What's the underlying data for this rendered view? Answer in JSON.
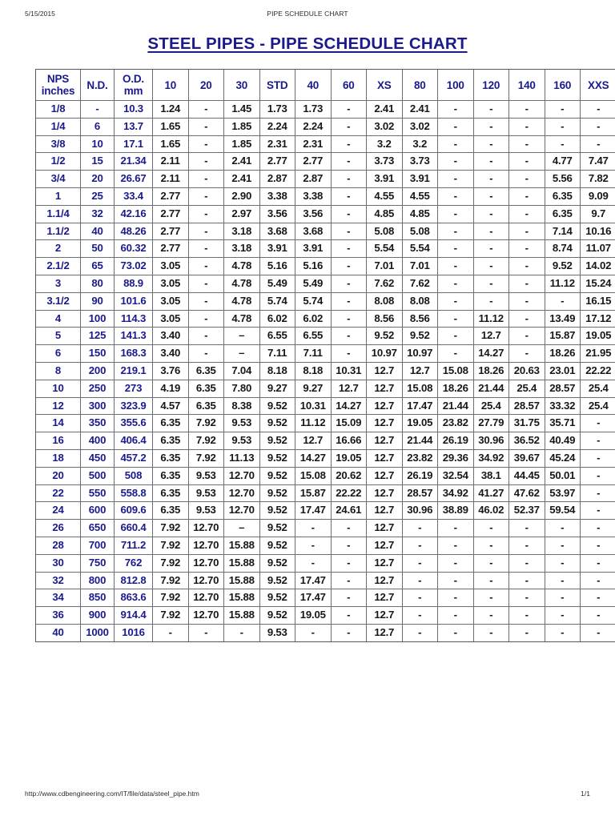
{
  "print_header": {
    "date": "5/15/2015",
    "title": "PIPE SCHEDULE CHART"
  },
  "print_footer": {
    "url": "http://www.cdbengineering.com/IT/file/data/steel_pipe.htm",
    "page": "1/1"
  },
  "document": {
    "title": "STEEL PIPES - PIPE SCHEDULE CHART",
    "title_color": "#1a1a8c"
  },
  "table": {
    "headers": [
      {
        "line1": "NPS",
        "line2": "inches"
      },
      {
        "line1": "N.D.",
        "line2": ""
      },
      {
        "line1": "O.D.",
        "line2": "mm"
      },
      {
        "line1": "10",
        "line2": ""
      },
      {
        "line1": "20",
        "line2": ""
      },
      {
        "line1": "30",
        "line2": ""
      },
      {
        "line1": "STD",
        "line2": ""
      },
      {
        "line1": "40",
        "line2": ""
      },
      {
        "line1": "60",
        "line2": ""
      },
      {
        "line1": "XS",
        "line2": ""
      },
      {
        "line1": "80",
        "line2": ""
      },
      {
        "line1": "100",
        "line2": ""
      },
      {
        "line1": "120",
        "line2": ""
      },
      {
        "line1": "140",
        "line2": ""
      },
      {
        "line1": "160",
        "line2": ""
      },
      {
        "line1": "XXS",
        "line2": ""
      }
    ],
    "rows": [
      [
        "1/8",
        "-",
        "10.3",
        "1.24",
        "-",
        "1.45",
        "1.73",
        "1.73",
        "-",
        "2.41",
        "2.41",
        "-",
        "-",
        "-",
        "-",
        "-"
      ],
      [
        "1/4",
        "6",
        "13.7",
        "1.65",
        "-",
        "1.85",
        "2.24",
        "2.24",
        "-",
        "3.02",
        "3.02",
        "-",
        "-",
        "-",
        "-",
        "-"
      ],
      [
        "3/8",
        "10",
        "17.1",
        "1.65",
        "-",
        "1.85",
        "2.31",
        "2.31",
        "-",
        "3.2",
        "3.2",
        "-",
        "-",
        "-",
        "-",
        "-"
      ],
      [
        "1/2",
        "15",
        "21.34",
        "2.11",
        "-",
        "2.41",
        "2.77",
        "2.77",
        "-",
        "3.73",
        "3.73",
        "-",
        "-",
        "-",
        "4.77",
        "7.47"
      ],
      [
        "3/4",
        "20",
        "26.67",
        "2.11",
        "-",
        "2.41",
        "2.87",
        "2.87",
        "-",
        "3.91",
        "3.91",
        "-",
        "-",
        "-",
        "5.56",
        "7.82"
      ],
      [
        "1",
        "25",
        "33.4",
        "2.77",
        "-",
        "2.90",
        "3.38",
        "3.38",
        "-",
        "4.55",
        "4.55",
        "-",
        "-",
        "-",
        "6.35",
        "9.09"
      ],
      [
        "1.1/4",
        "32",
        "42.16",
        "2.77",
        "-",
        "2.97",
        "3.56",
        "3.56",
        "-",
        "4.85",
        "4.85",
        "-",
        "-",
        "-",
        "6.35",
        "9.7"
      ],
      [
        "1.1/2",
        "40",
        "48.26",
        "2.77",
        "-",
        "3.18",
        "3.68",
        "3.68",
        "-",
        "5.08",
        "5.08",
        "-",
        "-",
        "-",
        "7.14",
        "10.16"
      ],
      [
        "2",
        "50",
        "60.32",
        "2.77",
        "-",
        "3.18",
        "3.91",
        "3.91",
        "-",
        "5.54",
        "5.54",
        "-",
        "-",
        "-",
        "8.74",
        "11.07"
      ],
      [
        "2.1/2",
        "65",
        "73.02",
        "3.05",
        "-",
        "4.78",
        "5.16",
        "5.16",
        "-",
        "7.01",
        "7.01",
        "-",
        "-",
        "-",
        "9.52",
        "14.02"
      ],
      [
        "3",
        "80",
        "88.9",
        "3.05",
        "-",
        "4.78",
        "5.49",
        "5.49",
        "-",
        "7.62",
        "7.62",
        "-",
        "-",
        "-",
        "11.12",
        "15.24"
      ],
      [
        "3.1/2",
        "90",
        "101.6",
        "3.05",
        "-",
        "4.78",
        "5.74",
        "5.74",
        "-",
        "8.08",
        "8.08",
        "-",
        "-",
        "-",
        "-",
        "16.15"
      ],
      [
        "4",
        "100",
        "114.3",
        "3.05",
        "-",
        "4.78",
        "6.02",
        "6.02",
        "-",
        "8.56",
        "8.56",
        "-",
        "11.12",
        "-",
        "13.49",
        "17.12"
      ],
      [
        "5",
        "125",
        "141.3",
        "3.40",
        "-",
        "–",
        "6.55",
        "6.55",
        "-",
        "9.52",
        "9.52",
        "-",
        "12.7",
        "-",
        "15.87",
        "19.05"
      ],
      [
        "6",
        "150",
        "168.3",
        "3.40",
        "-",
        "–",
        "7.11",
        "7.11",
        "-",
        "10.97",
        "10.97",
        "-",
        "14.27",
        "-",
        "18.26",
        "21.95"
      ],
      [
        "8",
        "200",
        "219.1",
        "3.76",
        "6.35",
        "7.04",
        "8.18",
        "8.18",
        "10.31",
        "12.7",
        "12.7",
        "15.08",
        "18.26",
        "20.63",
        "23.01",
        "22.22"
      ],
      [
        "10",
        "250",
        "273",
        "4.19",
        "6.35",
        "7.80",
        "9.27",
        "9.27",
        "12.7",
        "12.7",
        "15.08",
        "18.26",
        "21.44",
        "25.4",
        "28.57",
        "25.4"
      ],
      [
        "12",
        "300",
        "323.9",
        "4.57",
        "6.35",
        "8.38",
        "9.52",
        "10.31",
        "14.27",
        "12.7",
        "17.47",
        "21.44",
        "25.4",
        "28.57",
        "33.32",
        "25.4"
      ],
      [
        "14",
        "350",
        "355.6",
        "6.35",
        "7.92",
        "9.53",
        "9.52",
        "11.12",
        "15.09",
        "12.7",
        "19.05",
        "23.82",
        "27.79",
        "31.75",
        "35.71",
        "-"
      ],
      [
        "16",
        "400",
        "406.4",
        "6.35",
        "7.92",
        "9.53",
        "9.52",
        "12.7",
        "16.66",
        "12.7",
        "21.44",
        "26.19",
        "30.96",
        "36.52",
        "40.49",
        "-"
      ],
      [
        "18",
        "450",
        "457.2",
        "6.35",
        "7.92",
        "11.13",
        "9.52",
        "14.27",
        "19.05",
        "12.7",
        "23.82",
        "29.36",
        "34.92",
        "39.67",
        "45.24",
        "-"
      ],
      [
        "20",
        "500",
        "508",
        "6.35",
        "9.53",
        "12.70",
        "9.52",
        "15.08",
        "20.62",
        "12.7",
        "26.19",
        "32.54",
        "38.1",
        "44.45",
        "50.01",
        "-"
      ],
      [
        "22",
        "550",
        "558.8",
        "6.35",
        "9.53",
        "12.70",
        "9.52",
        "15.87",
        "22.22",
        "12.7",
        "28.57",
        "34.92",
        "41.27",
        "47.62",
        "53.97",
        "-"
      ],
      [
        "24",
        "600",
        "609.6",
        "6.35",
        "9.53",
        "12.70",
        "9.52",
        "17.47",
        "24.61",
        "12.7",
        "30.96",
        "38.89",
        "46.02",
        "52.37",
        "59.54",
        "-"
      ],
      [
        "26",
        "650",
        "660.4",
        "7.92",
        "12.70",
        "–",
        "9.52",
        "-",
        "-",
        "12.7",
        "-",
        "-",
        "-",
        "-",
        "-",
        "-"
      ],
      [
        "28",
        "700",
        "711.2",
        "7.92",
        "12.70",
        "15.88",
        "9.52",
        "-",
        "-",
        "12.7",
        "-",
        "-",
        "-",
        "-",
        "-",
        "-"
      ],
      [
        "30",
        "750",
        "762",
        "7.92",
        "12.70",
        "15.88",
        "9.52",
        "-",
        "-",
        "12.7",
        "-",
        "-",
        "-",
        "-",
        "-",
        "-"
      ],
      [
        "32",
        "800",
        "812.8",
        "7.92",
        "12.70",
        "15.88",
        "9.52",
        "17.47",
        "-",
        "12.7",
        "-",
        "-",
        "-",
        "-",
        "-",
        "-"
      ],
      [
        "34",
        "850",
        "863.6",
        "7.92",
        "12.70",
        "15.88",
        "9.52",
        "17.47",
        "-",
        "12.7",
        "-",
        "-",
        "-",
        "-",
        "-",
        "-"
      ],
      [
        "36",
        "900",
        "914.4",
        "7.92",
        "12.70",
        "15.88",
        "9.52",
        "19.05",
        "-",
        "12.7",
        "-",
        "-",
        "-",
        "-",
        "-",
        "-"
      ],
      [
        "40",
        "1000",
        "1016",
        "-",
        "-",
        "-",
        "9.53",
        "-",
        "-",
        "12.7",
        "-",
        "-",
        "-",
        "-",
        "-",
        "-"
      ]
    ]
  }
}
